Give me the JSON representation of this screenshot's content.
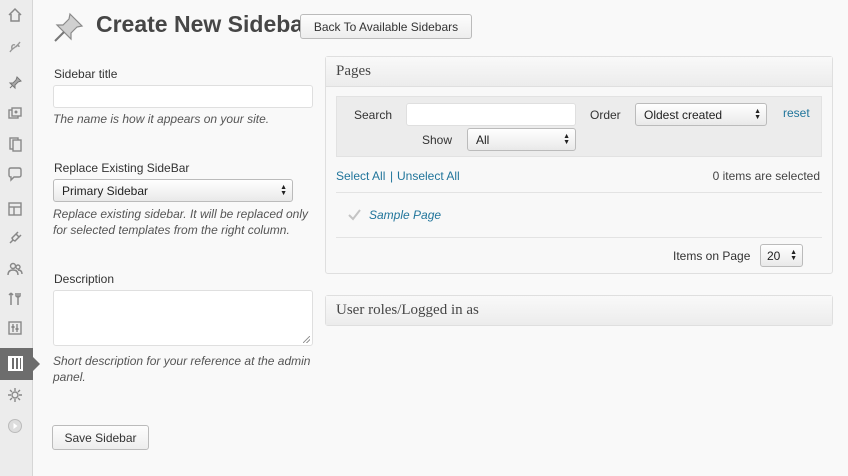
{
  "header": {
    "title": "Create New Sidebar",
    "back_button_label": "Back To Available Sidebars"
  },
  "form": {
    "sidebar_title": {
      "label": "Sidebar title",
      "value": "",
      "help": "The name is how it appears on your site."
    },
    "replace": {
      "label": "Replace Existing SideBar",
      "selected": "Primary Sidebar",
      "help_line1": "Replace existing sidebar. It will be replaced only",
      "help_line2": "for selected templates from the right column."
    },
    "description": {
      "label": "Description",
      "value": "",
      "help_line1": "Short description for your reference at the admin",
      "help_line2": "panel."
    },
    "save_label": "Save Sidebar"
  },
  "pages_panel": {
    "title": "Pages",
    "search_label": "Search",
    "search_value": "",
    "order_label": "Order",
    "order_selected": "Oldest created",
    "reset_label": "reset",
    "show_label": "Show",
    "show_selected": "All",
    "select_all_label": "Select All",
    "separator": "|",
    "unselect_all_label": "Unselect All",
    "selected_count_text": "0 items are selected",
    "items": [
      {
        "label": "Sample Page",
        "checked": false
      }
    ],
    "items_on_page_label": "Items on Page",
    "items_on_page_value": "20"
  },
  "roles_panel": {
    "title": "User roles/Logged in as"
  },
  "admin_menu": {
    "icons": [
      "dashboard-icon",
      "jetpack-icon",
      "posts-icon",
      "media-icon",
      "pages-icon",
      "comments-icon",
      "appearance-icon",
      "plugins-icon",
      "users-icon",
      "tools-icon",
      "settings-icon",
      "sidebars-icon",
      "gear-icon",
      "collapse-icon"
    ],
    "current": "sidebars-icon"
  },
  "colors": {
    "link": "#21759b",
    "title": "#464646",
    "admin_current": "#6d6d6d"
  }
}
